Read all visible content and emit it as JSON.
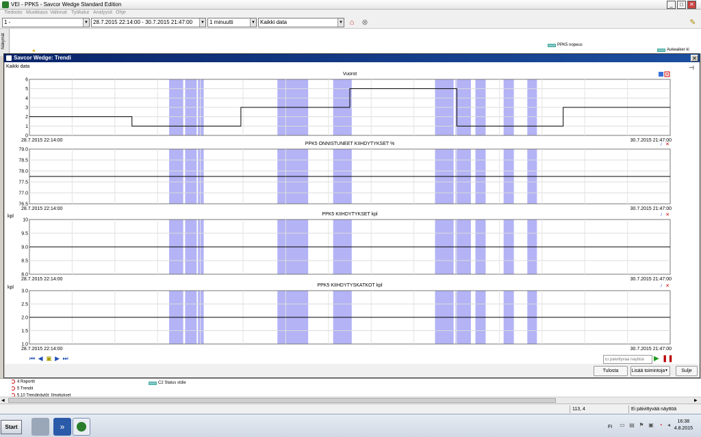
{
  "app": {
    "title": "VEI - PPK5 - Savcor Wedge Standard Edition",
    "menu": [
      "Tiedosto",
      "Muokkaus",
      "Valinnat",
      "Työkalut",
      "Analyysit",
      "Ohje"
    ]
  },
  "toolbar": {
    "selector_value": "1 -",
    "time_range": "28.7.2015 22:14:00  -  30.7.2015 21:47:00",
    "interval": "1 minuutti",
    "data_set": "Kaikki data",
    "home_icon": "home-icon",
    "stop_icon": "stop-icon",
    "tool_icon": "wrench-icon"
  },
  "background": {
    "side_tab": "Näkymät",
    "legend": [
      {
        "label": "PPK5 nopeus",
        "color": "#7fc7c7"
      },
      {
        "label": "Aukeaiker ki",
        "color": "#7fc7c7"
      }
    ]
  },
  "trend_window": {
    "title": "Savcor Wedge: Trendi",
    "dataset_label": "Kaikki data",
    "start_time": "28.7.2015 22:14:00",
    "end_time": "30.7.2015 21:47:00",
    "highlight_color": "#b3b3f5",
    "line_color": "#000000"
  },
  "chart_data": [
    {
      "type": "line",
      "title": "Vuorot",
      "ylabel": "",
      "ylim": [
        0,
        6
      ],
      "yticks": [
        "6",
        "5",
        "4",
        "3",
        "2",
        "1",
        "0"
      ],
      "step": true,
      "x": [
        0,
        0.16,
        0.16,
        0.33,
        0.33,
        0.5,
        0.5,
        0.667,
        0.667,
        0.833,
        0.833,
        1
      ],
      "values": [
        2,
        2,
        1,
        1,
        3,
        3,
        5,
        5,
        1,
        1,
        3,
        3
      ],
      "series": [
        {
          "values": [
            2,
            2,
            1,
            1,
            3,
            3,
            5,
            5,
            1,
            1,
            3,
            3
          ]
        }
      ],
      "icons": [
        "info-icon",
        "close-icon"
      ]
    },
    {
      "type": "line",
      "title": "PPK5 ONNISTUNEET KIIHDYTYKSET %",
      "ylabel": "",
      "ylim": [
        76.5,
        79.0
      ],
      "yticks": [
        "79.0",
        "78.5",
        "78.0",
        "77.5",
        "77.0",
        "76.5"
      ],
      "x": [
        0,
        1
      ],
      "values": [
        77.75,
        77.75
      ],
      "series": [
        {
          "values": [
            77.75,
            77.75
          ]
        }
      ],
      "icons": [
        "info-icon",
        "close-icon"
      ]
    },
    {
      "type": "line",
      "title": "PPK5 KIIHDYTYKSET kpl",
      "ylabel": "kpl",
      "ylim": [
        8.0,
        10.0
      ],
      "yticks": [
        "10",
        "9.5",
        "9.0",
        "8.5",
        "8.0"
      ],
      "x": [
        0,
        1
      ],
      "values": [
        9.0,
        9.0
      ],
      "series": [
        {
          "values": [
            9.0,
            9.0
          ]
        }
      ],
      "icons": [
        "info-icon",
        "close-icon"
      ]
    },
    {
      "type": "line",
      "title": "PPK5 KIIHDYTYSKATKOT kpl",
      "ylabel": "kpl",
      "ylim": [
        1.0,
        3.0
      ],
      "yticks": [
        "3.0",
        "2.5",
        "2.0",
        "1.5",
        "1.0"
      ],
      "x": [
        0,
        1
      ],
      "values": [
        2.0,
        2.0
      ],
      "series": [
        {
          "values": [
            2.0,
            2.0
          ]
        }
      ],
      "icons": [
        "info-icon",
        "close-icon"
      ]
    }
  ],
  "highlight_bands": [
    [
      0.218,
      0.24
    ],
    [
      0.243,
      0.261
    ],
    [
      0.263,
      0.272
    ],
    [
      0.387,
      0.435
    ],
    [
      0.474,
      0.503
    ],
    [
      0.633,
      0.662
    ],
    [
      0.665,
      0.689
    ],
    [
      0.696,
      0.712
    ],
    [
      0.74,
      0.756
    ],
    [
      0.777,
      0.792
    ]
  ],
  "nav": {
    "buttons": [
      "first-icon",
      "prev-icon",
      "pause-icon",
      "next-icon",
      "last-icon"
    ],
    "update_placeholder": "Ei päivittyvää näyttöä",
    "play_icon": "play-icon",
    "stop_icon": "stop-icon"
  },
  "footer": {
    "print": "Tulosta",
    "more_actions": "Lisää toimintoja",
    "close": "Sulje"
  },
  "lower_panel": {
    "items": [
      "4 Raportit",
      "5 Trendit",
      "5.10 Trendinäytöt_Ilmoitukset"
    ],
    "legend_label": "C2 Status stdie"
  },
  "status": {
    "coords": "113, 4",
    "update": "Ei päivittyvää näyttöä"
  },
  "taskbar": {
    "start": "Start",
    "language": "FI",
    "time": "16:38",
    "date": "4.8.2015"
  }
}
